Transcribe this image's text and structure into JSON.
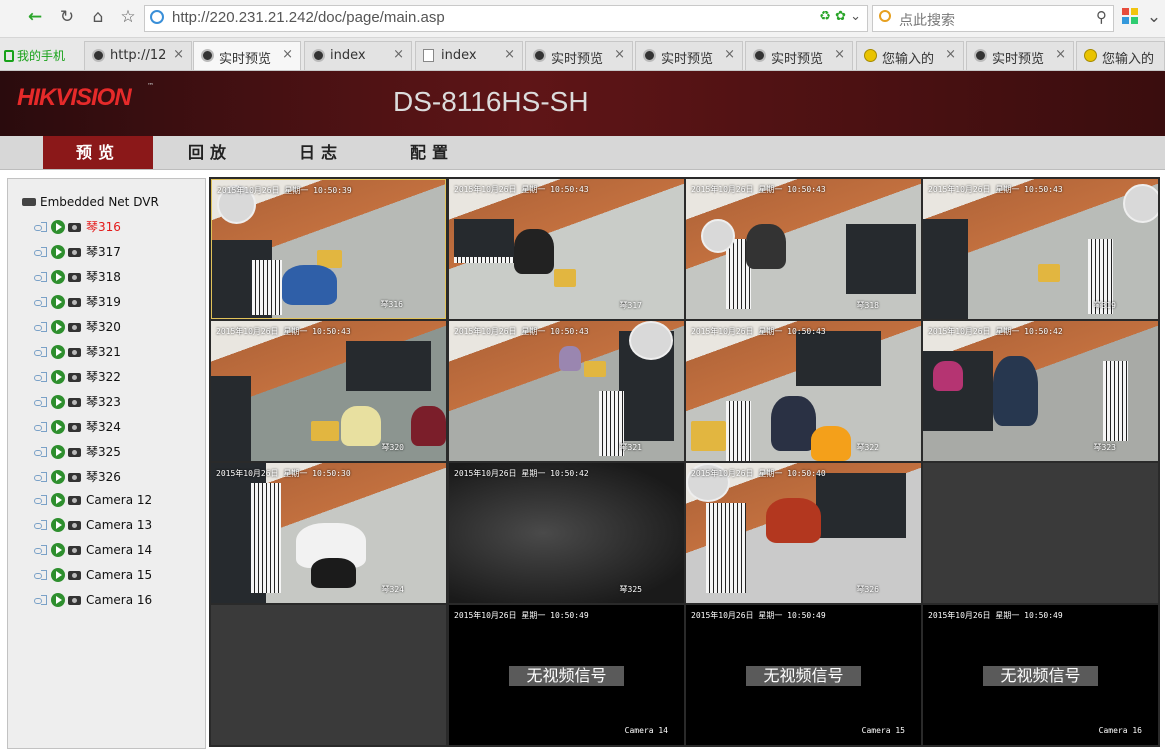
{
  "browser": {
    "url": "http://220.231.21.242/doc/page/main.asp",
    "search_placeholder": "点此搜索",
    "bookmark": "我的手机",
    "tabs": [
      {
        "label": "http://12",
        "icon": "globe-icon"
      },
      {
        "label": "实时预览",
        "icon": "globe-icon",
        "active": true
      },
      {
        "label": "index",
        "icon": "globe-icon"
      },
      {
        "label": "index",
        "icon": "document-icon"
      },
      {
        "label": "实时预览",
        "icon": "globe-icon"
      },
      {
        "label": "实时预览",
        "icon": "globe-icon"
      },
      {
        "label": "实时预览",
        "icon": "globe-icon"
      },
      {
        "label": "您输入的",
        "icon": "warning-icon"
      },
      {
        "label": "实时预览",
        "icon": "globe-icon"
      },
      {
        "label": "您输入的",
        "icon": "warning-icon"
      }
    ],
    "close_glyph": "×"
  },
  "app": {
    "logo": "HIKVISION",
    "model": "DS-8116HS-SH",
    "menu": [
      "预览",
      "回放",
      "日志",
      "配置"
    ],
    "accent_color": "#8b1819"
  },
  "device_tree": {
    "root": "Embedded Net DVR",
    "channels": [
      "琴316",
      "琴317",
      "琴318",
      "琴319",
      "琴320",
      "琴321",
      "琴322",
      "琴323",
      "琴324",
      "琴325",
      "琴326",
      "Camera 12",
      "Camera 13",
      "Camera 14",
      "Camera 15",
      "Camera 16"
    ],
    "selected": "琴316"
  },
  "video": {
    "tiles": [
      {
        "ts": "2015年10月26日 星期一 10:50:39",
        "label": "琴316",
        "selected": true
      },
      {
        "ts": "2015年10月26日 星期一 10:50:43",
        "label": "琴317"
      },
      {
        "ts": "2015年10月26日 星期一 10:50:43",
        "label": "琴318"
      },
      {
        "ts": "2015年10月26日 星期一 10:50:43",
        "label": "琴319"
      },
      {
        "ts": "2015年10月26日 星期一 10:50:43",
        "label": "琴320"
      },
      {
        "ts": "2015年10月26日 星期一 10:50:43",
        "label": "琴321"
      },
      {
        "ts": "2015年10月26日 星期一 10:50:43",
        "label": "琴322"
      },
      {
        "ts": "2015年10月26日 星期一 10:50:42",
        "label": "琴323"
      },
      {
        "ts": "2015年10月26日 星期一 10:50:30",
        "label": "琴324"
      },
      {
        "ts": "2015年10月26日 星期一 10:50:42",
        "label": "琴325"
      },
      {
        "ts": "2015年10月26日 星期一 10:50:40",
        "label": "琴326"
      },
      {
        "empty": true
      },
      {
        "empty": true
      },
      {
        "ts": "2015年10月26日 星期一 10:50:49",
        "label": "Camera 14",
        "no_signal": "无视频信号"
      },
      {
        "ts": "2015年10月26日 星期一 10:50:49",
        "label": "Camera 15",
        "no_signal": "无视频信号"
      },
      {
        "ts": "2015年10月26日 星期一 10:50:49",
        "label": "Camera 16",
        "no_signal": "无视频信号"
      }
    ]
  }
}
